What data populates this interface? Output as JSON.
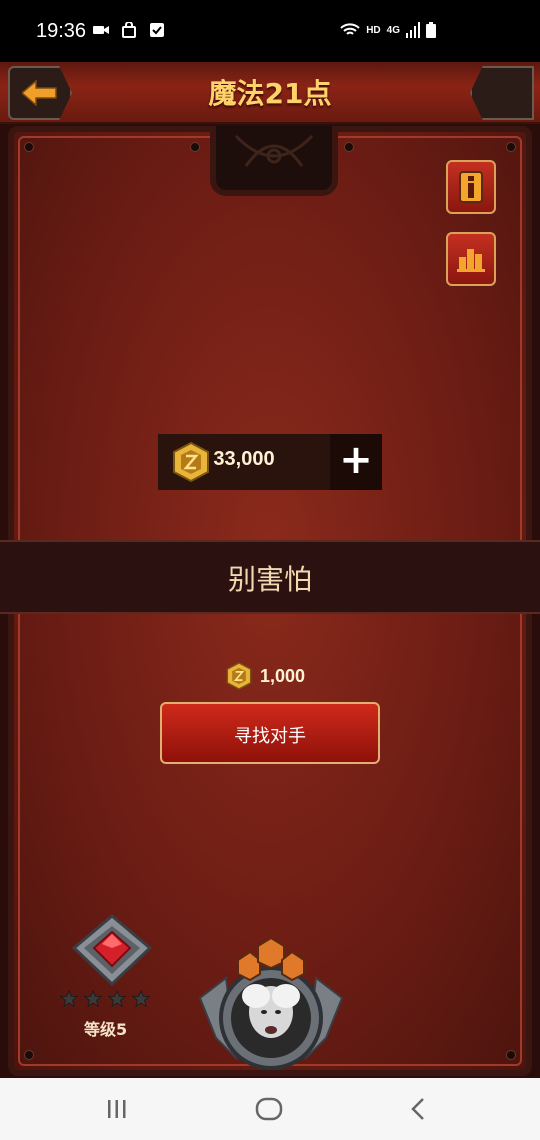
{
  "status_bar": {
    "time": "19:36",
    "left_icons": [
      "video-camera-icon",
      "shopping-bag-icon",
      "checkbox-icon"
    ],
    "right_icons": [
      "wifi-icon",
      "hd-icon",
      "4g-signal-icon",
      "battery-icon"
    ],
    "hd_text": "HD",
    "network_text": "4G"
  },
  "header": {
    "title": "魔法21点",
    "back_icon": "arrow-left-icon"
  },
  "side_buttons": {
    "info_icon": "info-icon",
    "leaderboard_icon": "bar-chart-icon"
  },
  "balance": {
    "amount": "33,000",
    "coin_icon": "coin-icon",
    "add_icon": "plus-icon"
  },
  "mode": {
    "title": "别害怕"
  },
  "stake": {
    "amount": "1,000"
  },
  "match_button": {
    "label": "寻找对手"
  },
  "player": {
    "rank_label": "等级5",
    "stars_total": 4,
    "stars_filled": 0,
    "badge_icon": "ruby-rank-badge-icon",
    "avatar": "player-avatar"
  },
  "colors": {
    "accent_gold": "#ffd36a",
    "panel_red": "#6d1d14",
    "button_red": "#cf2a1a"
  },
  "nav": {
    "recents_icon": "recents-icon",
    "home_icon": "home-icon",
    "back_icon": "nav-back-icon"
  }
}
